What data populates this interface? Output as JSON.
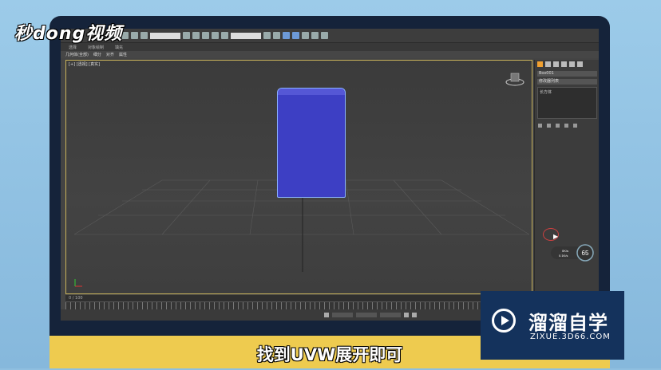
{
  "brand_logo": "秒dong视频",
  "ribbon": {
    "tabs": [
      "选择",
      "对象绘制",
      "填充"
    ]
  },
  "subribbon": {
    "items": [
      "几何体(全部)",
      "细分",
      "对齐",
      "属性"
    ]
  },
  "viewport": {
    "label": "[+] [透视] [真实]",
    "object_color": "#3d3fc4"
  },
  "command_panel": {
    "name_field": "Box001",
    "modifier_list": "修改器列表",
    "modifier_item": "长方体"
  },
  "timeline": {
    "frame": "0 / 100"
  },
  "speed_widget": {
    "percent": "65",
    "up": "0K/s",
    "down": "0.1K/s"
  },
  "caption": "找到UVW展开即可",
  "watermark": {
    "title": "溜溜自学",
    "subtitle": "ZIXUE.3D66.COM"
  }
}
